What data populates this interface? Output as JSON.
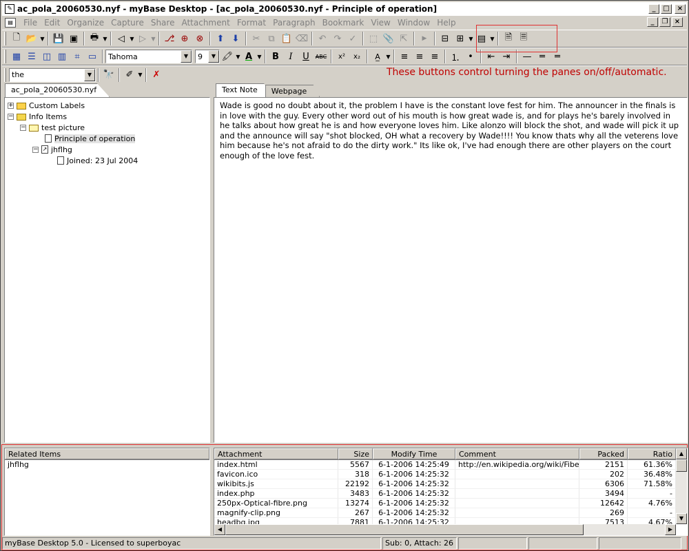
{
  "window": {
    "title": "ac_pola_20060530.nyf - myBase Desktop - [ac_pola_20060530.nyf - Principle of operation]"
  },
  "menu": [
    "File",
    "Edit",
    "Organize",
    "Capture",
    "Share",
    "Attachment",
    "Format",
    "Paragraph",
    "Bookmark",
    "View",
    "Window",
    "Help"
  ],
  "format_toolbar": {
    "font": "Tahoma",
    "size": "9"
  },
  "search": {
    "value": "the"
  },
  "annotation": "These buttons control turning the panes on/off/automatic.",
  "left_tab": "ac_pola_20060530.nyf",
  "tree": [
    {
      "label": "Custom Labels"
    },
    {
      "label": "Info Items"
    },
    {
      "label": "test picture"
    },
    {
      "label": "Principle of operation"
    },
    {
      "label": "jhflhg"
    },
    {
      "label": "Joined: 23 Jul 2004"
    }
  ],
  "right_tabs": [
    "Text Note",
    "Webpage"
  ],
  "note_text": "Wade is good no doubt about it, the problem I have is the constant love fest for him. The announcer in the finals is in love with the guy. Every other word out of his mouth is how great wade is, and for plays he's barely involved in he talks about how great he is and how everyone loves him. Like alonzo will block the shot, and wade will pick it up and the announce will say \"shot blocked, OH what a recovery by Wade!!!! You know thats why all the veterens love him because he's not afraid to do the dirty work.\" Its like ok, I've had enough there are other players on the court enough of the love fest.",
  "related": {
    "header": "Related Items",
    "items": [
      "jhflhg"
    ]
  },
  "attachments": {
    "columns": [
      "Attachment",
      "Size",
      "Modify Time",
      "Comment",
      "Packed",
      "Ratio"
    ],
    "rows": [
      [
        "index.html",
        "5567",
        "6-1-2006 14:25:49",
        "http://en.wikipedia.org/wiki/Fibe...",
        "2151",
        "61.36%"
      ],
      [
        "favicon.ico",
        "318",
        "6-1-2006 14:25:32",
        "",
        "202",
        "36.48%"
      ],
      [
        "wikibits.js",
        "22192",
        "6-1-2006 14:25:32",
        "",
        "6306",
        "71.58%"
      ],
      [
        "index.php",
        "3483",
        "6-1-2006 14:25:32",
        "",
        "3494",
        "-"
      ],
      [
        "250px-Optical-fibre.png",
        "13274",
        "6-1-2006 14:25:32",
        "",
        "12642",
        "4.76%"
      ],
      [
        "magnify-clip.png",
        "267",
        "6-1-2006 14:25:32",
        "",
        "269",
        "-"
      ],
      [
        "headbg.jpg",
        "7881",
        "6-1-2006 14:25:32",
        "",
        "7513",
        "4.67%"
      ]
    ]
  },
  "status": {
    "left": "myBase Desktop 5.0 - Licensed to superboyac",
    "mid": "Sub: 0, Attach: 26"
  },
  "colors": {
    "annotation": "#c00000",
    "highlight_box": "#e03030"
  }
}
